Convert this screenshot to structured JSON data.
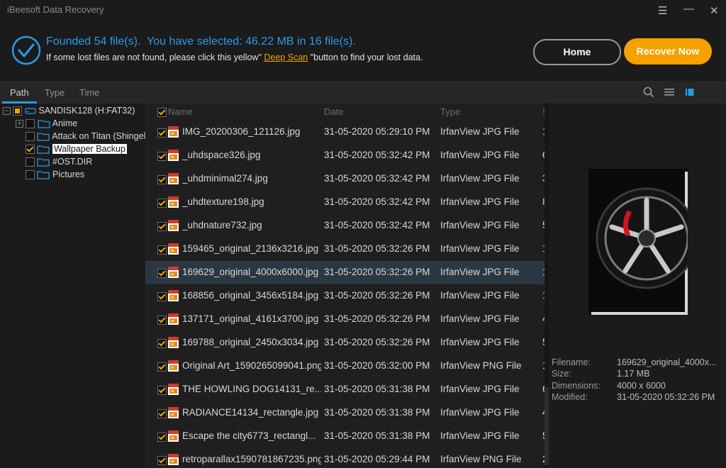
{
  "app": {
    "title": "iBeesoft Data Recovery"
  },
  "window": {
    "menu_glyph": "☰",
    "minimize_glyph": "—",
    "close_glyph": "✕"
  },
  "header": {
    "status_founded": "Founded 54 file(s).",
    "status_selected": "You have selected: 46.22 MB in 16 file(s).",
    "hint_before": "If some lost files are not found, please click this yellow\"",
    "deep_scan": "Deep Scan",
    "hint_after": "\"button to find your lost data.",
    "home_label": "Home",
    "recover_label": "Recover Now"
  },
  "tabs": [
    {
      "label": "Path",
      "active": true
    },
    {
      "label": "Type",
      "active": false
    },
    {
      "label": "Time",
      "active": false
    }
  ],
  "toolbar_icons": [
    "search-icon",
    "list-view-icon",
    "thumbnail-view-icon"
  ],
  "tree": {
    "root": {
      "label": "SANDISK128 (H:FAT32)",
      "state": "partial"
    },
    "children": [
      {
        "label": "Anime",
        "state": "unchecked",
        "expandable": true
      },
      {
        "label": "Attack on Titan (Shingel",
        "state": "unchecked",
        "expandable": false
      },
      {
        "label": "Wallpaper Backup",
        "state": "checked",
        "expandable": false,
        "highlighted": true
      },
      {
        "label": "#OST.DIR",
        "state": "unchecked",
        "expandable": false
      },
      {
        "label": "Pictures",
        "state": "unchecked",
        "expandable": false
      }
    ]
  },
  "list": {
    "columns": {
      "name": "Name",
      "date": "Date",
      "type": "Type",
      "size": "S"
    },
    "rows": [
      {
        "name": "IMG_20200306_121126.jpg",
        "date": "31-05-2020 05:29:10 PM",
        "type": "IrfanView JPG File",
        "size": "1"
      },
      {
        "name": "_uhdspace326.jpg",
        "date": "31-05-2020 05:32:42 PM",
        "type": "IrfanView JPG File",
        "size": "6"
      },
      {
        "name": "_uhdminimal274.jpg",
        "date": "31-05-2020 05:32:42 PM",
        "type": "IrfanView JPG File",
        "size": "3"
      },
      {
        "name": "_uhdtexture198.jpg",
        "date": "31-05-2020 05:32:42 PM",
        "type": "IrfanView JPG File",
        "size": "8"
      },
      {
        "name": "_uhdnature732.jpg",
        "date": "31-05-2020 05:32:42 PM",
        "type": "IrfanView JPG File",
        "size": "5"
      },
      {
        "name": "159465_original_2136x3216.jpg",
        "date": "31-05-2020 05:32:26 PM",
        "type": "IrfanView JPG File",
        "size": "1"
      },
      {
        "name": "169629_original_4000x6000.jpg",
        "date": "31-05-2020 05:32:26 PM",
        "type": "IrfanView JPG File",
        "size": "1",
        "selected": true
      },
      {
        "name": "168856_original_3456x5184.jpg",
        "date": "31-05-2020 05:32:26 PM",
        "type": "IrfanView JPG File",
        "size": "1"
      },
      {
        "name": "137171_original_4161x3700.jpg",
        "date": "31-05-2020 05:32:26 PM",
        "type": "IrfanView JPG File",
        "size": "4"
      },
      {
        "name": "169788_original_2450x3034.jpg",
        "date": "31-05-2020 05:32:26 PM",
        "type": "IrfanView JPG File",
        "size": "5"
      },
      {
        "name": "Original Art_1590265099041.png",
        "date": "31-05-2020 05:32:00 PM",
        "type": "IrfanView PNG File",
        "size": "1"
      },
      {
        "name": "THE HOWLING DOG14131_re...",
        "date": "31-05-2020 05:31:38 PM",
        "type": "IrfanView JPG File",
        "size": "6"
      },
      {
        "name": "RADIANCE14134_rectangle.jpg",
        "date": "31-05-2020 05:31:38 PM",
        "type": "IrfanView JPG File",
        "size": "4"
      },
      {
        "name": "Escape the city6773_rectangl...",
        "date": "31-05-2020 05:31:38 PM",
        "type": "IrfanView JPG File",
        "size": "5"
      },
      {
        "name": "retroparallax1590781867235.png",
        "date": "31-05-2020 05:29:44 PM",
        "type": "IrfanView PNG File",
        "size": "2"
      }
    ]
  },
  "preview": {
    "filename_label": "Filename:",
    "filename_value": "169629_original_4000x...",
    "size_label": "Size:",
    "size_value": "1.17 MB",
    "dimensions_label": "Dimensions:",
    "dimensions_value": "4000 x 6000",
    "modified_label": "Modified:",
    "modified_value": "31-05-2020 05:32:26 PM"
  },
  "colors": {
    "accent_blue": "#2a9be8",
    "accent_orange": "#f5a100",
    "selected_row": "#2c3744"
  }
}
